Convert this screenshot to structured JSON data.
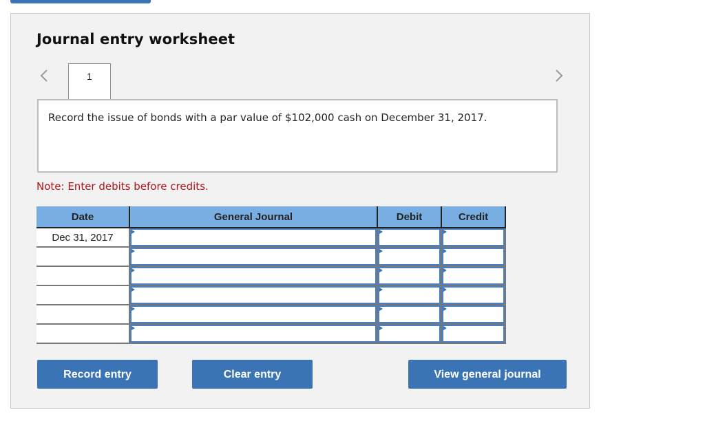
{
  "worksheet": {
    "title": "Journal entry worksheet",
    "current_step": "1",
    "prev_icon": "chevron-left-icon",
    "next_icon": "chevron-right-icon",
    "question": "Record the issue of bonds with a par value of $102,000 cash on December 31, 2017.",
    "note": "Note: Enter debits before credits."
  },
  "table": {
    "columns": [
      "Date",
      "General Journal",
      "Debit",
      "Credit"
    ],
    "rows": [
      {
        "date": "Dec 31, 2017",
        "general_journal": "",
        "debit": "",
        "credit": ""
      },
      {
        "date": "",
        "general_journal": "",
        "debit": "",
        "credit": ""
      },
      {
        "date": "",
        "general_journal": "",
        "debit": "",
        "credit": ""
      },
      {
        "date": "",
        "general_journal": "",
        "debit": "",
        "credit": ""
      },
      {
        "date": "",
        "general_journal": "",
        "debit": "",
        "credit": ""
      },
      {
        "date": "",
        "general_journal": "",
        "debit": "",
        "credit": ""
      }
    ]
  },
  "buttons": {
    "record": "Record entry",
    "clear": "Clear entry",
    "view": "View general journal"
  },
  "colors": {
    "button_blue": "#3b74b5",
    "header_blue": "#79aee2",
    "note_red": "#b3141b",
    "panel_bg": "#f2f2f2"
  }
}
